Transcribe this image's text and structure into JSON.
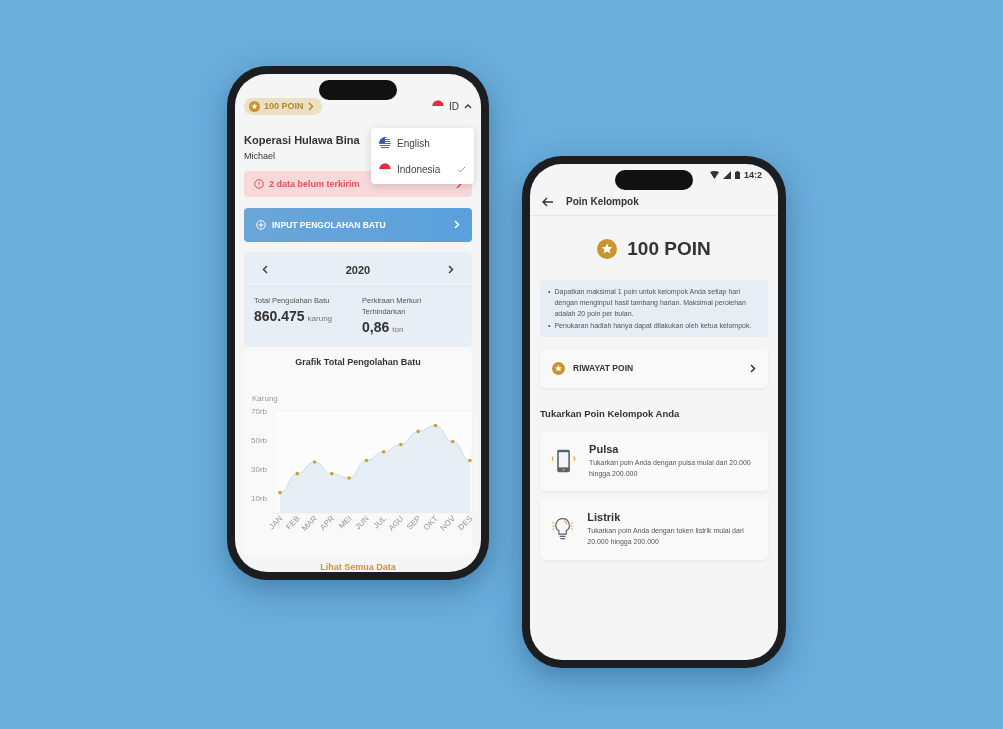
{
  "home_screen": {
    "points_badge": "100 POIN",
    "language": {
      "code": "ID",
      "expanded": true,
      "options": [
        {
          "label": "English",
          "kind": "us",
          "selected": false
        },
        {
          "label": "Indonesia",
          "kind": "id",
          "selected": true
        }
      ]
    },
    "cooperative": "Koperasi Hulawa Bina",
    "user": "Michael",
    "alert": "2 data belum terkirim",
    "action_button": "INPUT PENGOLAHAN BATU",
    "year": "2020",
    "stats": [
      {
        "label": "Total Pengolahan Batu",
        "value": "860.475",
        "unit": "karung"
      },
      {
        "label": "Perkiraan Merkuri Terhindarkan",
        "value": "0,86",
        "unit": "ton"
      }
    ],
    "chart": {
      "chart_data": {
        "type": "area",
        "title": "Grafik Total Pengolahan Batu",
        "ylabel": "Karung",
        "categories": [
          "JAN",
          "FEB",
          "MAR",
          "APR",
          "MEI",
          "JUN",
          "JUL",
          "AGU",
          "SEP",
          "OKT",
          "NOV",
          "DES"
        ],
        "series": [
          {
            "color": "#e6edf5",
            "values": [
              14,
              27,
              35,
              27,
              24,
              36,
              42,
              47,
              56,
              60,
              49,
              36
            ]
          }
        ],
        "ylim": [
          0,
          70
        ],
        "yticks": [
          {
            "value": 10,
            "label": "10rb"
          },
          {
            "value": 30,
            "label": "30rb"
          },
          {
            "value": 50,
            "label": "50rb"
          },
          {
            "value": 70,
            "label": "70rb"
          }
        ]
      }
    },
    "footer_link": "Lihat Semua Data"
  },
  "points_screen": {
    "status_time": "14:2",
    "title": "Poin Kelompok",
    "points": "100 POIN",
    "info": [
      {
        "bullet": "•",
        "text": "Dapatkan maksimal 1 poin untuk kelompok Anda setiap hari dengan menginput hasil tambang harian. Maksimal perolehan adalah 20 poin per bulan."
      },
      {
        "bullet": "•",
        "text": "Penukaran hadiah hanya dapat dilakukan oleh ketua kelompok."
      }
    ],
    "history": "RIWAYAT POIN",
    "section_title": "Tukarkan Poin Kelompok Anda",
    "rewards": [
      {
        "kind": "phone",
        "title": "Pulsa",
        "description": "Tukarkan poin Anda dengan pulsa mulai dari 20.000 hingga 200.000"
      },
      {
        "kind": "bulb",
        "title": "Listrik",
        "description": "Tukarkan poin Anda dengan token listrik mulai dari 20.000 hingga 200.000"
      }
    ]
  }
}
